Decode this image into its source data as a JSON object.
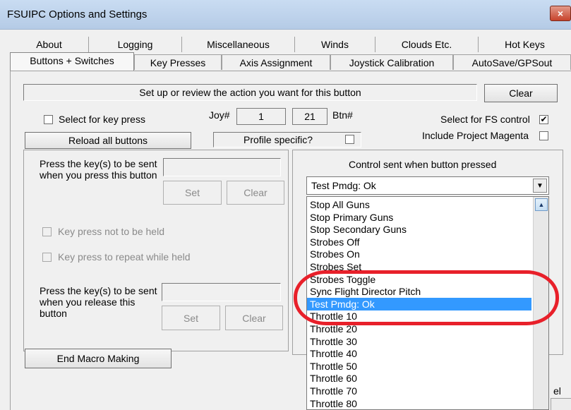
{
  "window": {
    "title": "FSUIPC Options and Settings",
    "close_label": "×"
  },
  "tabs": {
    "row1": [
      "About",
      "Logging",
      "Miscellaneous",
      "Winds",
      "Clouds Etc.",
      "Hot Keys"
    ],
    "row2": [
      "Buttons + Switches",
      "Key Presses",
      "Axis Assignment",
      "Joystick Calibration",
      "AutoSave/GPSout"
    ],
    "active": "Buttons + Switches"
  },
  "instruction": "Set up or review the action you want for this button",
  "clear_label": "Clear",
  "select_key_press_label": "Select for key press",
  "joy_label": "Joy#",
  "joy_value": "1",
  "btn_value": "21",
  "btn_label": "Btn#",
  "select_fs_label": "Select for FS control",
  "select_fs_checked": "✔",
  "reload_label": "Reload all buttons",
  "profile_specific_label": "Profile specific?",
  "include_magenta_label": "Include Project Magenta",
  "keys": {
    "press_label": "Press the key(s) to be sent when you press this button",
    "release_label": "Press the key(s) to be sent when you release this button",
    "set_label": "Set",
    "clear_label": "Clear",
    "not_held_label": "Key press not to be held",
    "repeat_label": "Key press to repeat while held"
  },
  "end_macro_label": "End Macro Making",
  "control": {
    "group_label": "Control sent when button pressed",
    "selected": "Test Pmdg: Ok",
    "items": [
      "Stop All Guns",
      "Stop Primary Guns",
      "Stop Secondary Guns",
      "Strobes Off",
      "Strobes On",
      "Strobes Set",
      "Strobes Toggle",
      "Sync Flight Director Pitch",
      "Test Pmdg: Ok",
      "Throttle 10",
      "Throttle 20",
      "Throttle 30",
      "Throttle 40",
      "Throttle 50",
      "Throttle 60",
      "Throttle 70",
      "Throttle 80"
    ],
    "selected_index": 8
  },
  "partial_text": "el",
  "colors": {
    "selection": "#3399ff",
    "annotation": "#e8202a"
  }
}
